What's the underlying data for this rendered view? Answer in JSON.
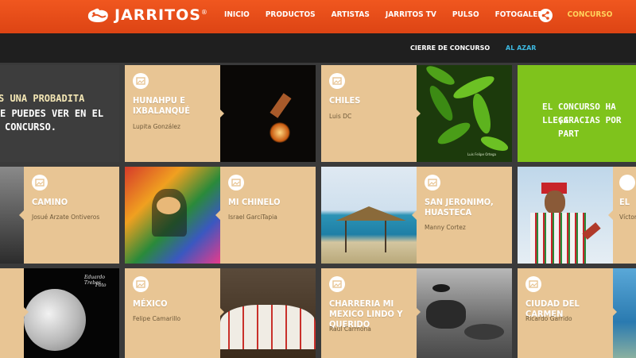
{
  "brand": {
    "name": "JARRITOS",
    "reg": "®"
  },
  "nav": {
    "items": [
      {
        "label": "INICIO"
      },
      {
        "label": "PRODUCTOS"
      },
      {
        "label": "ARTISTAS"
      },
      {
        "label": "JARRITOS TV"
      },
      {
        "label": "PULSO"
      },
      {
        "label": "FOTOGALERÍA"
      },
      {
        "label": "CONCURSO"
      }
    ],
    "active": "CONCURSO"
  },
  "subnav": {
    "tab1": "CIERRE DE CONCURSO",
    "tab2": "AL AZAR"
  },
  "promo_left": {
    "line1": "S UNA PROBADITA",
    "line2": "E PUEDES VER EN EL",
    "line3": "CONCURSO."
  },
  "promo_right": {
    "line1": "EL CONCURSO HA LLEGA",
    "line2": "¡GRACIAS POR PART"
  },
  "cards": [
    {
      "title": "HUNAHPU E IXBALANQUÉ",
      "author": "Lupita González"
    },
    {
      "title": "CHILES",
      "author": "Luis DC"
    },
    {
      "title": "CAMINO",
      "author": "Josué Arzate Ontiveros"
    },
    {
      "title": "MI CHINELO",
      "author": "Israel GarciTapia"
    },
    {
      "title": "SAN JERONIMO, HUASTECA",
      "author": "Manny Cortez"
    },
    {
      "title": "EL",
      "author": "Víctor"
    },
    {
      "title": "MÉXICO",
      "author": "Felipe Camarillo"
    },
    {
      "title": "CHARRERIA MI MEXICO LINDO Y QUERIDO",
      "author": "Raúl Carmona"
    },
    {
      "title": "CIUDAD DEL CARMEN",
      "author": "Ricardo Garrido"
    }
  ],
  "moon_caption": {
    "line1": "Eduardo Trebes",
    "line2": "Foto"
  },
  "chiles_caption": "Luis Felipe Ortega",
  "colors": {
    "header": "#e84e1b",
    "accent_yellow": "#ffd35c",
    "subnav_blue": "#3db8e0",
    "card": "#e8c594",
    "green": "#7fc31c"
  }
}
